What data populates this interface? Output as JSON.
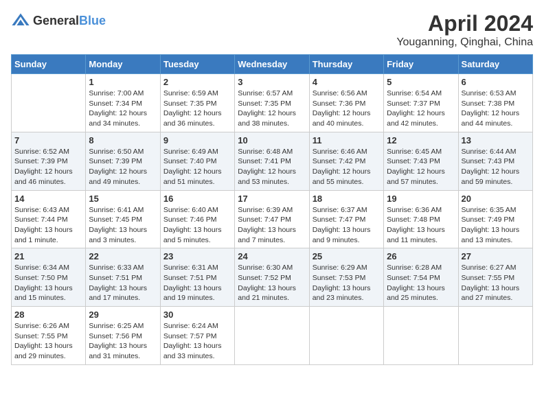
{
  "header": {
    "logo_general": "General",
    "logo_blue": "Blue",
    "month": "April 2024",
    "location": "Youganning, Qinghai, China"
  },
  "days_of_week": [
    "Sunday",
    "Monday",
    "Tuesday",
    "Wednesday",
    "Thursday",
    "Friday",
    "Saturday"
  ],
  "weeks": [
    [
      {
        "num": "",
        "info": ""
      },
      {
        "num": "1",
        "info": "Sunrise: 7:00 AM\nSunset: 7:34 PM\nDaylight: 12 hours\nand 34 minutes."
      },
      {
        "num": "2",
        "info": "Sunrise: 6:59 AM\nSunset: 7:35 PM\nDaylight: 12 hours\nand 36 minutes."
      },
      {
        "num": "3",
        "info": "Sunrise: 6:57 AM\nSunset: 7:35 PM\nDaylight: 12 hours\nand 38 minutes."
      },
      {
        "num": "4",
        "info": "Sunrise: 6:56 AM\nSunset: 7:36 PM\nDaylight: 12 hours\nand 40 minutes."
      },
      {
        "num": "5",
        "info": "Sunrise: 6:54 AM\nSunset: 7:37 PM\nDaylight: 12 hours\nand 42 minutes."
      },
      {
        "num": "6",
        "info": "Sunrise: 6:53 AM\nSunset: 7:38 PM\nDaylight: 12 hours\nand 44 minutes."
      }
    ],
    [
      {
        "num": "7",
        "info": "Sunrise: 6:52 AM\nSunset: 7:39 PM\nDaylight: 12 hours\nand 46 minutes."
      },
      {
        "num": "8",
        "info": "Sunrise: 6:50 AM\nSunset: 7:39 PM\nDaylight: 12 hours\nand 49 minutes."
      },
      {
        "num": "9",
        "info": "Sunrise: 6:49 AM\nSunset: 7:40 PM\nDaylight: 12 hours\nand 51 minutes."
      },
      {
        "num": "10",
        "info": "Sunrise: 6:48 AM\nSunset: 7:41 PM\nDaylight: 12 hours\nand 53 minutes."
      },
      {
        "num": "11",
        "info": "Sunrise: 6:46 AM\nSunset: 7:42 PM\nDaylight: 12 hours\nand 55 minutes."
      },
      {
        "num": "12",
        "info": "Sunrise: 6:45 AM\nSunset: 7:43 PM\nDaylight: 12 hours\nand 57 minutes."
      },
      {
        "num": "13",
        "info": "Sunrise: 6:44 AM\nSunset: 7:43 PM\nDaylight: 12 hours\nand 59 minutes."
      }
    ],
    [
      {
        "num": "14",
        "info": "Sunrise: 6:43 AM\nSunset: 7:44 PM\nDaylight: 13 hours\nand 1 minute."
      },
      {
        "num": "15",
        "info": "Sunrise: 6:41 AM\nSunset: 7:45 PM\nDaylight: 13 hours\nand 3 minutes."
      },
      {
        "num": "16",
        "info": "Sunrise: 6:40 AM\nSunset: 7:46 PM\nDaylight: 13 hours\nand 5 minutes."
      },
      {
        "num": "17",
        "info": "Sunrise: 6:39 AM\nSunset: 7:47 PM\nDaylight: 13 hours\nand 7 minutes."
      },
      {
        "num": "18",
        "info": "Sunrise: 6:37 AM\nSunset: 7:47 PM\nDaylight: 13 hours\nand 9 minutes."
      },
      {
        "num": "19",
        "info": "Sunrise: 6:36 AM\nSunset: 7:48 PM\nDaylight: 13 hours\nand 11 minutes."
      },
      {
        "num": "20",
        "info": "Sunrise: 6:35 AM\nSunset: 7:49 PM\nDaylight: 13 hours\nand 13 minutes."
      }
    ],
    [
      {
        "num": "21",
        "info": "Sunrise: 6:34 AM\nSunset: 7:50 PM\nDaylight: 13 hours\nand 15 minutes."
      },
      {
        "num": "22",
        "info": "Sunrise: 6:33 AM\nSunset: 7:51 PM\nDaylight: 13 hours\nand 17 minutes."
      },
      {
        "num": "23",
        "info": "Sunrise: 6:31 AM\nSunset: 7:51 PM\nDaylight: 13 hours\nand 19 minutes."
      },
      {
        "num": "24",
        "info": "Sunrise: 6:30 AM\nSunset: 7:52 PM\nDaylight: 13 hours\nand 21 minutes."
      },
      {
        "num": "25",
        "info": "Sunrise: 6:29 AM\nSunset: 7:53 PM\nDaylight: 13 hours\nand 23 minutes."
      },
      {
        "num": "26",
        "info": "Sunrise: 6:28 AM\nSunset: 7:54 PM\nDaylight: 13 hours\nand 25 minutes."
      },
      {
        "num": "27",
        "info": "Sunrise: 6:27 AM\nSunset: 7:55 PM\nDaylight: 13 hours\nand 27 minutes."
      }
    ],
    [
      {
        "num": "28",
        "info": "Sunrise: 6:26 AM\nSunset: 7:55 PM\nDaylight: 13 hours\nand 29 minutes."
      },
      {
        "num": "29",
        "info": "Sunrise: 6:25 AM\nSunset: 7:56 PM\nDaylight: 13 hours\nand 31 minutes."
      },
      {
        "num": "30",
        "info": "Sunrise: 6:24 AM\nSunset: 7:57 PM\nDaylight: 13 hours\nand 33 minutes."
      },
      {
        "num": "",
        "info": ""
      },
      {
        "num": "",
        "info": ""
      },
      {
        "num": "",
        "info": ""
      },
      {
        "num": "",
        "info": ""
      }
    ]
  ]
}
